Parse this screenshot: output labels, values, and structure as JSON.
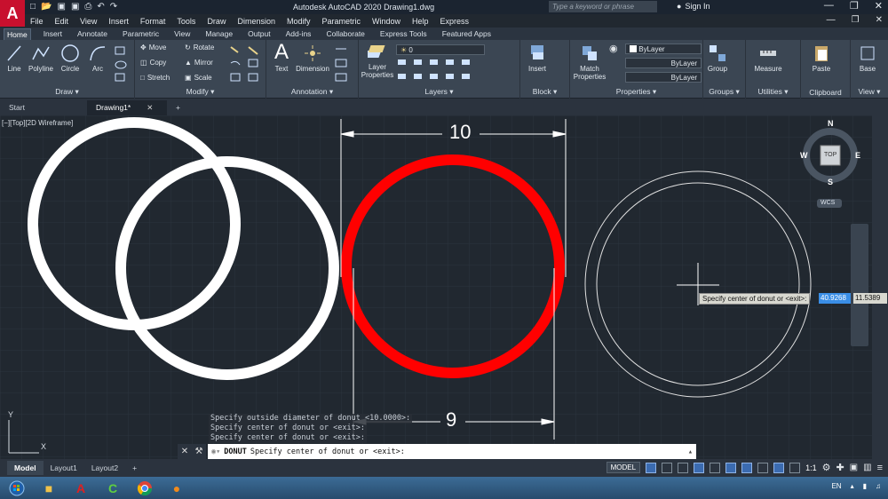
{
  "title_bar": {
    "app_logo": "A",
    "title": "Autodesk AutoCAD 2020   Drawing1.dwg",
    "search_placeholder": "Type a keyword or phrase",
    "sign_in": "Sign In"
  },
  "menu": [
    "File",
    "Edit",
    "View",
    "Insert",
    "Format",
    "Tools",
    "Draw",
    "Dimension",
    "Modify",
    "Parametric",
    "Window",
    "Help",
    "Express"
  ],
  "ribbon_tabs": [
    "Home",
    "Insert",
    "Annotate",
    "Parametric",
    "View",
    "Manage",
    "Output",
    "Add-ins",
    "Collaborate",
    "Express Tools",
    "Featured Apps"
  ],
  "ribbon": {
    "draw": {
      "title": "Draw",
      "line": "Line",
      "polyline": "Polyline",
      "circle": "Circle",
      "arc": "Arc"
    },
    "modify": {
      "title": "Modify",
      "move": "Move",
      "rotate": "Rotate",
      "copy": "Copy",
      "mirror": "Mirror",
      "stretch": "Stretch",
      "scale": "Scale"
    },
    "annotation": {
      "title": "Annotation",
      "text": "Text",
      "dimension": "Dimension"
    },
    "layers": {
      "title": "Layers",
      "layer_properties": "Layer\nProperties",
      "current_layer": "0"
    },
    "block": {
      "title": "Block",
      "insert": "Insert"
    },
    "properties": {
      "title": "Properties",
      "match": "Match\nProperties",
      "color": "ByLayer",
      "linetype": "ByLayer",
      "lineweight": "ByLayer"
    },
    "groups": {
      "title": "Groups",
      "group": "Group"
    },
    "utilities": {
      "title": "Utilities",
      "measure": "Measure"
    },
    "clipboard": {
      "title": "Clipboard",
      "paste": "Paste"
    },
    "view": {
      "title": "View",
      "base": "Base"
    }
  },
  "file_tabs": {
    "start": "Start",
    "drawing": "Drawing1*"
  },
  "viewport_label": "[−][Top][2D Wireframe]",
  "viewcube": {
    "n": "N",
    "s": "S",
    "e": "E",
    "w": "W",
    "top": "TOP",
    "wcs": "WCS"
  },
  "dimensions": {
    "top": "10",
    "bottom": "9"
  },
  "dynamic_input": {
    "prompt": "Specify center of donut or <exit>:",
    "x": "40.9268",
    "y": "11.5389"
  },
  "command_history": [
    "Specify outside diameter of donut <10.0000>:",
    "Specify center of donut or <exit>:",
    "Specify center of donut or <exit>:"
  ],
  "command_line": {
    "command": "DONUT",
    "prompt": "Specify center of donut or <exit>:"
  },
  "layout_tabs": [
    "Model",
    "Layout1",
    "Layout2"
  ],
  "status": {
    "model": "MODEL",
    "scale": "1:1"
  },
  "taskbar": {
    "lang": "EN"
  },
  "colors": {
    "donut_white": "#ffffff",
    "donut_red": "#ff0000",
    "canvas": "#212830"
  }
}
